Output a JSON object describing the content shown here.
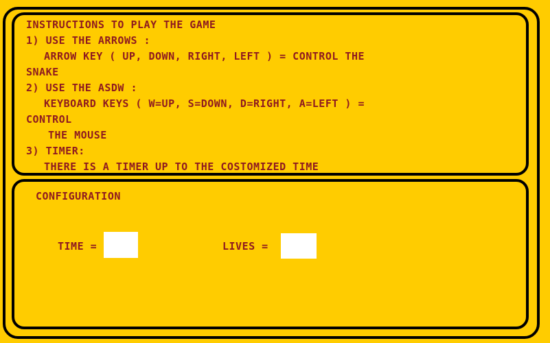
{
  "instructions": {
    "title": "INSTRUCTIONS TO PLAY THE GAME",
    "line1": "1) USE THE ARROWS :",
    "line2": "ARROW KEY ( UP, DOWN, RIGHT, LEFT ) = CONTROL THE",
    "line3": "SNAKE",
    "line4": "2) USE THE ASDW :",
    "line5": "KEYBOARD KEYS ( W=UP, S=DOWN, D=RIGHT, A=LEFT ) =",
    "line6": "CONTROL",
    "line7": "THE MOUSE",
    "line8": "3) TIMER:",
    "line9": "THERE IS A TIMER UP TO THE COSTOMIZED TIME"
  },
  "config": {
    "title": "CONFIGURATION",
    "time_label": "TIME =",
    "time_value": "",
    "lives_label": "LIVES =",
    "lives_value": ""
  },
  "colors": {
    "background": "#FFCC00",
    "text": "#8E1A20",
    "border": "#000000"
  }
}
